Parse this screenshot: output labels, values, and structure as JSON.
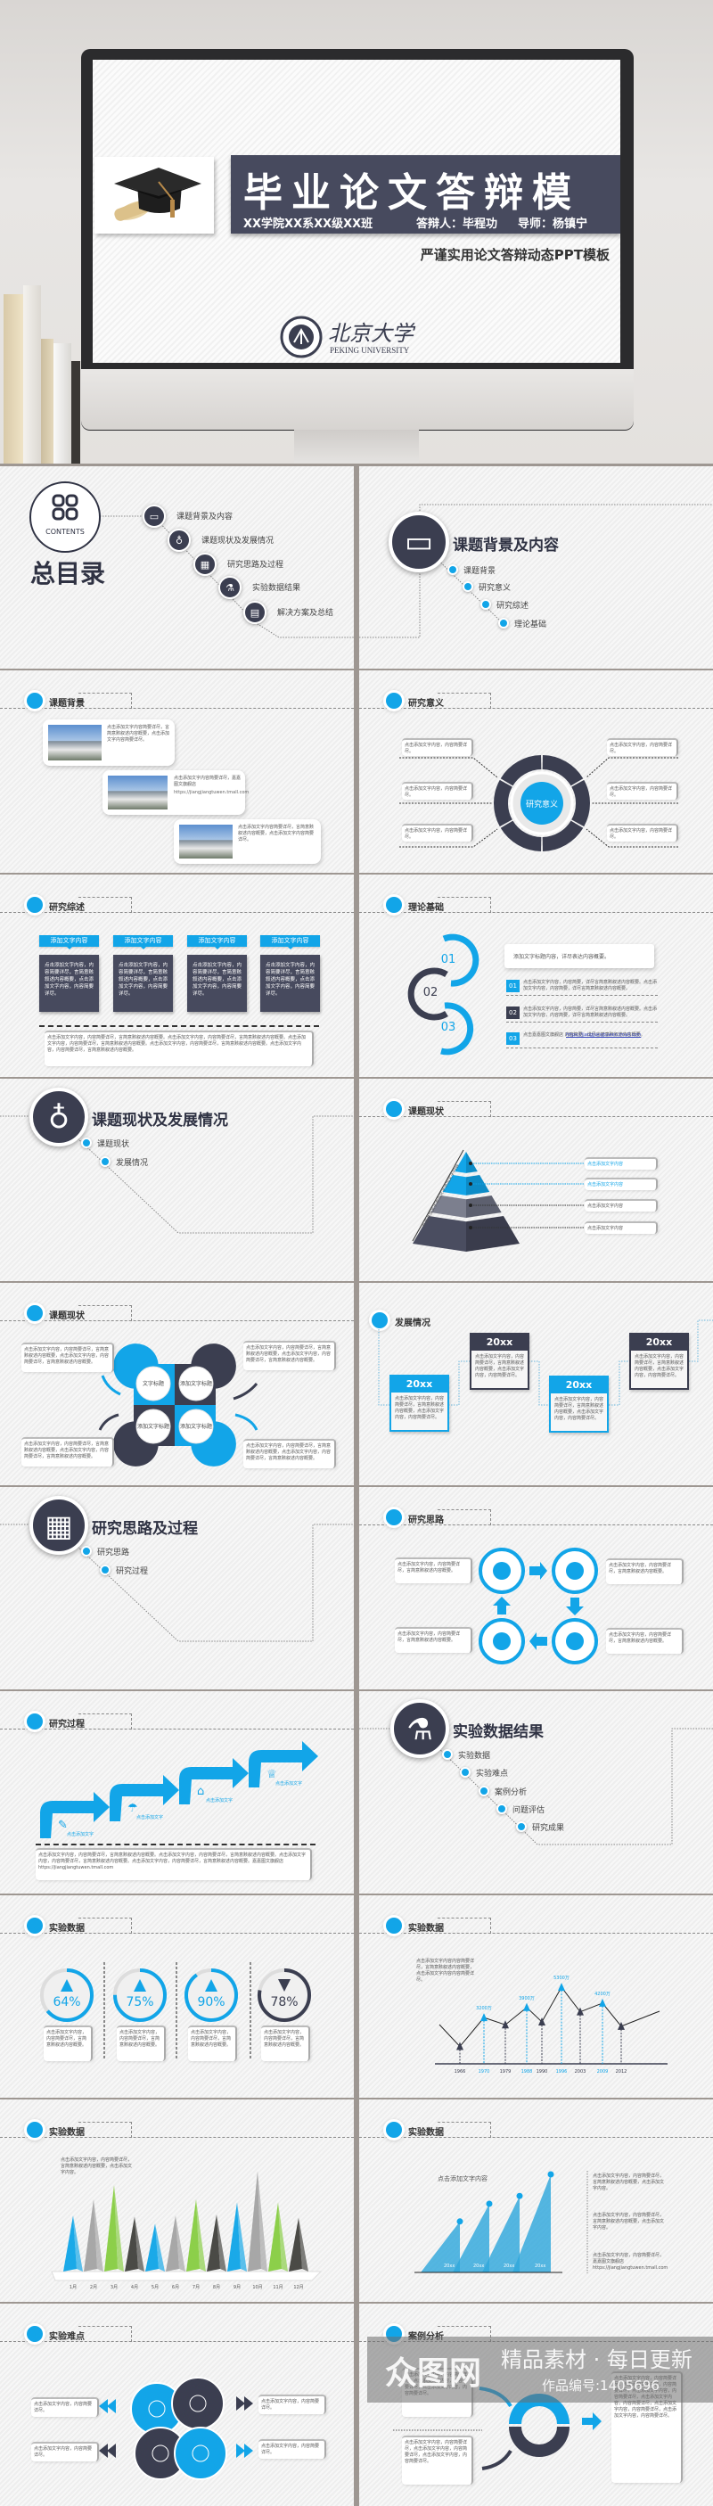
{
  "colors": {
    "accent": "#12a5e8",
    "dark": "#3b3e50"
  },
  "hero": {
    "title": "毕业论文答辩模",
    "college": "XX学院XX系XX级XX班",
    "defender": "答辩人：毕程功",
    "advisor": "导师：杨镇宁",
    "subtitle": "严谨实用论文答辩动态PPT模板",
    "logo_cn": "北京大学",
    "logo_en": "PEKING UNIVERSITY"
  },
  "contents": {
    "badge": "CONTENTS",
    "title": "总目录",
    "items": [
      {
        "label": "课题背景及内容",
        "icon": "laptop-icon",
        "glyph": "▭"
      },
      {
        "label": "课题现状及发展情况",
        "icon": "apple-icon",
        "glyph": "♁"
      },
      {
        "label": "研究思路及过程",
        "icon": "calculator-icon",
        "glyph": "▦"
      },
      {
        "label": "实验数据结果",
        "icon": "flask-icon",
        "glyph": "⚗"
      },
      {
        "label": "解决方案及总结",
        "icon": "document-icon",
        "glyph": "▤"
      }
    ]
  },
  "section1": {
    "title": "课题背景及内容",
    "items": [
      "课题背景",
      "研究意义",
      "研究综述",
      "理论基础"
    ]
  },
  "background": {
    "title": "课题背景",
    "cards": [
      {
        "text": "点击添加文字内容简要详尽，言简意赅叙述内容概要，点击添加文字内容简要详尽。",
        "link": ""
      },
      {
        "text": "点击添加文字内容简要详尽，嘉嘉图文旗舰店",
        "link": "https://jiangjiangtuwen.tmall.com"
      },
      {
        "text": "点击添加文字内容简要详尽，言简意赅叙述内容概要，点击添加文字内容简要详尽。",
        "link": ""
      }
    ]
  },
  "significance": {
    "title": "研究意义",
    "center": "研究意义",
    "boxes": [
      "点击添加文字内容，内容简要详尽。",
      "点击添加文字内容，内容简要详尽。",
      "点击添加文字内容，内容简要详尽。",
      "点击添加文字内容，内容简要详尽。",
      "点击添加文字内容，内容简要详尽。",
      "点击添加文字内容，内容简要详尽。"
    ]
  },
  "review": {
    "title": "研究综述",
    "columns": [
      {
        "head": "添加文字内容",
        "body": "点击添加文字内容，内容简要详尽，言简意赅叙述内容概要，点击添加文字内容，内容简要详尽。"
      },
      {
        "head": "添加文字内容",
        "body": "点击添加文字内容，内容简要详尽，言简意赅叙述内容概要，点击添加文字内容，内容简要详尽。"
      },
      {
        "head": "添加文字内容",
        "body": "点击添加文字内容，内容简要详尽，言简意赅叙述内容概要，点击添加文字内容，内容简要详尽。"
      },
      {
        "head": "添加文字内容",
        "body": "点击添加文字内容，内容简要详尽，言简意赅叙述内容概要，点击添加文字内容，内容简要详尽。"
      }
    ],
    "footer": "点击添加文字内容，内容简要详尽，言简意赅叙述内容概要。点击添加文字内容，内容简要详尽，言简意赅叙述内容概要。点击添加文字内容，内容简要详尽，言简意赅叙述内容概要。点击添加文字内容，内容简要详尽，言简意赅叙述内容概要。点击添加文字内容，内容简要详尽，言简意赅叙述内容概要。"
  },
  "theory": {
    "title": "理论基础",
    "rings": [
      "01",
      "02",
      "03"
    ],
    "headline": "添加文字标题内容，详尽表达内容概要。",
    "items": [
      {
        "num": "01",
        "text": "点击添加文字内容，内容简要，详尽言简意赅叙述内容概要。点击添加文字内容，内容简要，详尽言简意赅叙述内容概要。"
      },
      {
        "num": "02",
        "text": "点击添加文字内容，内容简要，详尽言简意赅叙述内容概要。点击添加文字内容，内容简要，详尽言简意赅叙述内容概要。"
      },
      {
        "num": "03",
        "text": "点击嘉嘉图文旗舰店 内容简要，详尽言简意赅叙述内容概要。",
        "link": "https://jiangjiangtuwen.tmall.com"
      }
    ]
  },
  "section2": {
    "title": "课题现状及发展情况",
    "items": [
      "课题现状",
      "发展情况"
    ]
  },
  "pyramid": {
    "title": "课题现状",
    "side_text": "点击添加文字添加文字添加文字内容",
    "labels": [
      "点击添加文字内容",
      "点击添加文字内容",
      "点击添加文字内容",
      "点击添加文字内容"
    ]
  },
  "status": {
    "title": "课题现状",
    "petals": [
      "文字标题",
      "添加文字标题",
      "添加文字标题",
      "添加文字标题"
    ],
    "boxes": [
      "点击添加文字内容，内容简要详尽，言简意赅叙述内容概要，点击添加文字内容，内容简要详尽，言简意赅叙述内容概要。",
      "点击添加文字内容，内容简要详尽，言简意赅叙述内容概要，点击添加文字内容，内容简要详尽，言简意赅叙述内容概要。",
      "点击添加文字内容，内容简要详尽，言简意赅叙述内容概要，点击添加文字内容，内容简要详尽，言简意赅叙述内容概要。",
      "点击添加文字内容，内容简要详尽，言简意赅叙述内容概要，点击添加文字内容，内容简要详尽，言简意赅叙述内容概要。"
    ]
  },
  "development": {
    "title": "发展情况",
    "cards": [
      {
        "year": "20xx",
        "text": "点击添加文字内容，内容简要详尽，言简意赅叙述内容概要，点击添加文字内容，内容简要详尽。"
      },
      {
        "year": "20xx",
        "text": "点击添加文字内容，内容简要详尽，言简意赅叙述内容概要，点击添加文字内容，内容简要详尽。"
      },
      {
        "year": "20xx",
        "text": "点击添加文字内容，内容简要详尽，言简意赅叙述内容概要，点击添加文字内容，内容简要详尽。"
      },
      {
        "year": "20xx",
        "text": "点击添加文字内容，内容简要详尽，言简意赅叙述内容概要，点击添加文字内容，内容简要详尽。"
      }
    ]
  },
  "section3": {
    "title": "研究思路及过程",
    "items": [
      "研究思路",
      "研究过程"
    ]
  },
  "ideas": {
    "title": "研究思路",
    "boxes": [
      "点击添加文字内容，内容简要详尽，言简意赅叙述内容概要。",
      "点击添加文字内容，内容简要详尽，言简意赅叙述内容概要。",
      "点击添加文字内容，内容简要详尽，言简意赅叙述内容概要。",
      "点击添加文字内容，内容简要详尽，言简意赅叙述内容概要。"
    ],
    "icons": [
      "head-gears-icon",
      "exchange-icon",
      "network-icon",
      "coin-box-icon"
    ]
  },
  "process": {
    "title": "研究过程",
    "steps": [
      {
        "label": "点击添加文字",
        "icon": "feather-icon",
        "glyph": "✎"
      },
      {
        "label": "点击添加文字",
        "icon": "umbrella-icon",
        "glyph": "☂"
      },
      {
        "label": "点击添加文字",
        "icon": "tag-icon",
        "glyph": "⌂"
      },
      {
        "label": "点击添加文字",
        "icon": "trophy-icon",
        "glyph": "♕"
      }
    ],
    "footer": "点击添加文字内容，内容简要详尽，言简意赅叙述内容概要。点击添加文字内容，内容简要详尽，言简意赅叙述内容概要。点击添加文字内容，内容简要详尽，言简意赅叙述内容概要。点击添加文字内容，内容简要详尽，言简意赅叙述内容概要。嘉嘉图文旗舰店 https://jiangjiangtuwen.tmall.com"
  },
  "section4": {
    "title": "实验数据结果",
    "items": [
      "实验数据",
      "实验难点",
      "案例分析",
      "问题评估",
      "研究成果"
    ]
  },
  "percent": {
    "title": "实验数据",
    "items": [
      {
        "value": 64,
        "label": "64%",
        "trend": "up",
        "text": "点击添加文字内容，内容简要详尽，言简意赅叙述内容概要。"
      },
      {
        "value": 75,
        "label": "75%",
        "trend": "up",
        "text": "点击添加文字内容，内容简要详尽，言简意赅叙述内容概要。"
      },
      {
        "value": 90,
        "label": "90%",
        "trend": "up",
        "text": "点击添加文字内容，内容简要详尽，言简意赅叙述内容概要。"
      },
      {
        "value": 78,
        "label": "78%",
        "trend": "down",
        "text": "点击添加文字内容，内容简要详尽，言简意赅叙述内容概要。"
      }
    ]
  },
  "linechart": {
    "title": "实验数据",
    "text": "点击添加文字内容内容简要详尽，言简意赅叙述内容概要，点击添加文字内容内容简要详尽。"
  },
  "barchart": {
    "title": "实验数据",
    "text": "点击添加文字内容，内容简要详尽，言简意赅叙述内容概要，点击添加文字内容。"
  },
  "trichart": {
    "title": "实验数据",
    "caption": "点击添加文字内容",
    "notes": [
      "点击添加文字内容，内容简要详尽，言简意赅叙述内容概要，点击添加文字内容。",
      "点击添加文字内容，内容简要详尽，言简意赅叙述内容概要，点击添加文字内容。",
      "点击添加文字内容，内容简要详尽，嘉嘉图文旗舰店"
    ],
    "link": "https://jiangjiangtuwen.tmall.com"
  },
  "difficulty": {
    "title": "实验难点",
    "boxes": [
      "点击添加文字内容，内容简要详尽。",
      "点击添加文字内容，内容简要详尽。",
      "点击添加文字内容，内容简要详尽。",
      "点击添加文字内容，内容简要详尽。"
    ]
  },
  "cases": {
    "title": "案例分析",
    "boxes": [
      "点击添加文字内容，内容简要详尽，点击添加文字内容，内容简要详尽，点击添加文字内容，内容简要详尽。",
      "点击添加文字内容，内容简要详尽，点击添加文字内容，内容简要详尽，点击添加文字内容，内容简要详尽。",
      "点击添加文字内容，内容简要详尽，点击添加文字内容，内容简要详尽，点击添加文字内容，内容简要详尽，点击添加文字内容，内容简要详尽，点击添加文字内容，内容简要详尽，点击添加文字内容，内容简要详尽。"
    ]
  },
  "watermark": {
    "logo": "众图网",
    "slogan": "精品素材 · 每日更新",
    "code": "作品编号:1405696"
  },
  "chart_data": [
    {
      "type": "line",
      "x": [
        "1966",
        "1970",
        "1979",
        "1988",
        "1990",
        "1996",
        "2003",
        "2009",
        "2012"
      ],
      "values": [
        1200,
        3200,
        2700,
        3900,
        2900,
        5300,
        3600,
        4200,
        2600
      ],
      "data_labels": {
        "1970": "3200万",
        "1988": "3900万",
        "1996": "5300万",
        "2009": "4200万"
      },
      "highlighted": [
        "1970",
        "1988",
        "1996",
        "2009"
      ],
      "ylim": [
        0,
        5800
      ]
    },
    {
      "type": "bar",
      "categories": [
        "1月",
        "2月",
        "3月",
        "4月",
        "5月",
        "6月",
        "7月",
        "8月",
        "9月",
        "10月",
        "11月",
        "12月"
      ],
      "values": [
        55,
        71,
        85,
        54,
        47,
        55,
        71,
        56,
        68,
        99,
        68,
        53
      ],
      "bar_colors": [
        "#1aa9e8",
        "#a7a7a7",
        "#8ccf4a",
        "#4a4a46"
      ],
      "ylim": [
        0,
        100
      ]
    },
    {
      "type": "area",
      "categories": [
        "20xx",
        "20xx",
        "20xx",
        "20xx"
      ],
      "values": [
        52,
        70,
        78,
        100
      ],
      "ylim": [
        0,
        100
      ]
    }
  ]
}
